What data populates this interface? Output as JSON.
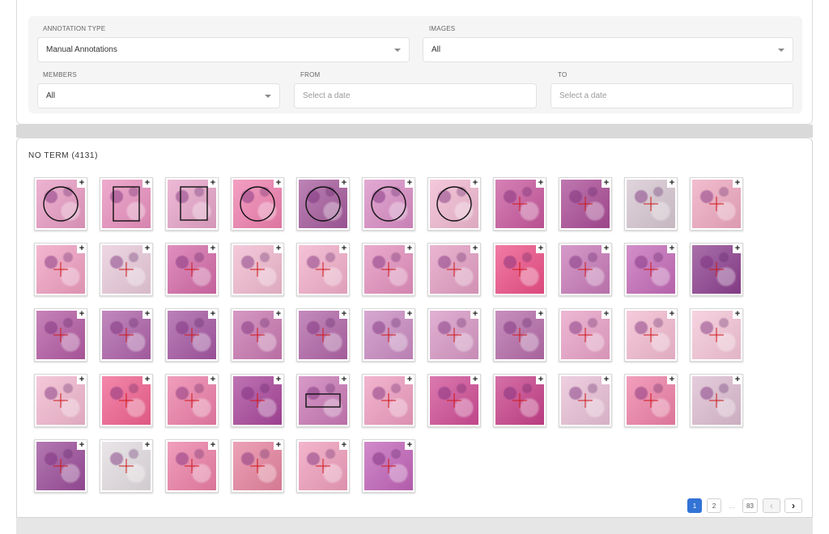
{
  "filters": {
    "annotation_type": {
      "label": "ANNOTATION TYPE",
      "value": "Manual Annotations"
    },
    "images": {
      "label": "IMAGES",
      "value": "All"
    },
    "members": {
      "label": "MEMBERS",
      "value": "All"
    },
    "from": {
      "label": "FROM",
      "placeholder": "Select a date"
    },
    "to": {
      "label": "TO",
      "placeholder": "Select a date"
    }
  },
  "term_group": {
    "title": "NO TERM (4131)",
    "add_glyph": "+",
    "thumbnails": [
      {
        "annotation": "circle",
        "tint": "#e79ac2"
      },
      {
        "annotation": "rectangle",
        "tint": "#e88fbd"
      },
      {
        "annotation": "rectangle",
        "tint": "#e6a3c8"
      },
      {
        "annotation": "circle",
        "tint": "#ef7fae"
      },
      {
        "annotation": "circle",
        "tint": "#a55a9c"
      },
      {
        "annotation": "circle",
        "tint": "#d88cc4"
      },
      {
        "annotation": "circle",
        "tint": "#f0b7cf"
      },
      {
        "annotation": "point",
        "tint": "#c8579d"
      },
      {
        "annotation": "point",
        "tint": "#a94a95"
      },
      {
        "annotation": "point",
        "tint": "#d6c6d0"
      },
      {
        "annotation": "point",
        "tint": "#eea7bf"
      },
      {
        "annotation": "point",
        "tint": "#ef9ec0"
      },
      {
        "annotation": "point",
        "tint": "#e8c9d9"
      },
      {
        "annotation": "point",
        "tint": "#d46aa8"
      },
      {
        "annotation": "point",
        "tint": "#f0b8ce"
      },
      {
        "annotation": "point",
        "tint": "#f1adc8"
      },
      {
        "annotation": "point",
        "tint": "#e38fbd"
      },
      {
        "annotation": "point",
        "tint": "#e39dc2"
      },
      {
        "annotation": "point",
        "tint": "#ec4f86"
      },
      {
        "annotation": "point",
        "tint": "#c779b7"
      },
      {
        "annotation": "point",
        "tint": "#c46ab8"
      },
      {
        "annotation": "point",
        "tint": "#8c3f8e"
      },
      {
        "annotation": "point",
        "tint": "#b35aa2"
      },
      {
        "annotation": "point",
        "tint": "#ad61a8"
      },
      {
        "annotation": "point",
        "tint": "#a456a2"
      },
      {
        "annotation": "point",
        "tint": "#c877b0"
      },
      {
        "annotation": "point",
        "tint": "#b064a6"
      },
      {
        "annotation": "point",
        "tint": "#c98ac1"
      },
      {
        "annotation": "point",
        "tint": "#d797c4"
      },
      {
        "annotation": "point",
        "tint": "#b56ba8"
      },
      {
        "annotation": "point",
        "tint": "#e8a0c6"
      },
      {
        "annotation": "point",
        "tint": "#f2b9cf"
      },
      {
        "annotation": "point",
        "tint": "#f4c4d6"
      },
      {
        "annotation": "point",
        "tint": "#f1b6cd"
      },
      {
        "annotation": "point",
        "tint": "#f0608f"
      },
      {
        "annotation": "point",
        "tint": "#ec7da6"
      },
      {
        "annotation": "point",
        "tint": "#a8459a"
      },
      {
        "annotation": "rectangle",
        "tint": "#c978b5"
      },
      {
        "annotation": "point",
        "tint": "#ee9cbf"
      },
      {
        "annotation": "point",
        "tint": "#cf4c95"
      },
      {
        "annotation": "point",
        "tint": "#c7408a"
      },
      {
        "annotation": "point",
        "tint": "#e8bfd5"
      },
      {
        "annotation": "point",
        "tint": "#ee7fa6"
      },
      {
        "annotation": "point",
        "tint": "#dcbcd0"
      },
      {
        "annotation": "point",
        "tint": "#9a4c99"
      },
      {
        "annotation": "point",
        "tint": "#e2dce0"
      },
      {
        "annotation": "point",
        "tint": "#ec7ea6"
      },
      {
        "annotation": "point",
        "tint": "#e6839f"
      },
      {
        "annotation": "point",
        "tint": "#ef9dbb"
      },
      {
        "annotation": "point",
        "tint": "#c163b8"
      }
    ]
  },
  "pagination": {
    "pages": [
      "1",
      "2",
      "...",
      "83"
    ],
    "current": "1",
    "prev": "‹",
    "next": "›"
  }
}
